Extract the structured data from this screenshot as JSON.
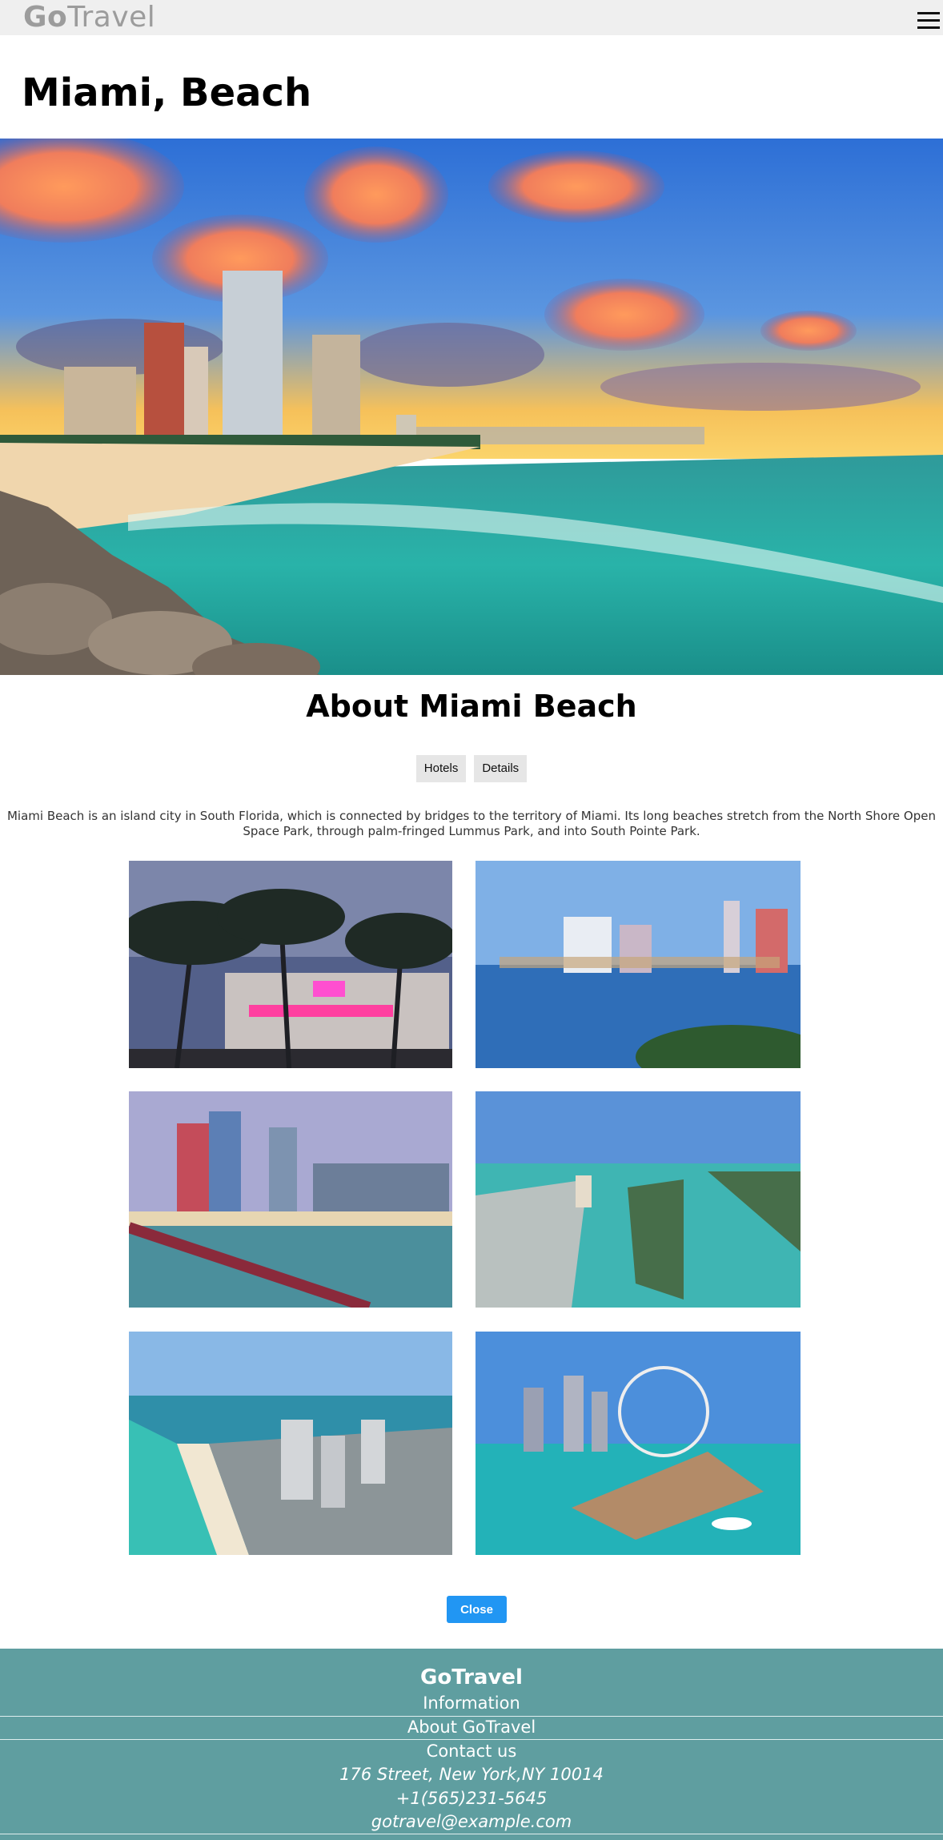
{
  "header": {
    "logo_bold": "Go",
    "logo_light": "Travel",
    "menu_icon": "hamburger-menu-icon"
  },
  "page": {
    "title": "Miami, Beach"
  },
  "about": {
    "title": "About Miami Beach",
    "tabs": [
      {
        "label": "Hotels"
      },
      {
        "label": "Details"
      }
    ],
    "description": "Miami Beach is an island city in South Florida, which is connected by bridges to the territory of Miami. Its long beaches stretch from the North Shore Open Space Park, through palm-fringed Lummus Park, and into South Pointe Park."
  },
  "actions": {
    "close_label": "Close"
  },
  "footer": {
    "brand": "GoTravel",
    "links": [
      {
        "label": "Information"
      },
      {
        "label": "About GoTravel"
      },
      {
        "label": "Contact us"
      }
    ],
    "address": "176 Street, New York,NY 10014",
    "phone": "+1(565)231-5645",
    "email": "gotravel@example.com"
  },
  "colors": {
    "footer_bg": "#5f9ea0",
    "close_button": "#2196f3",
    "topbar_bg": "#efefef"
  }
}
